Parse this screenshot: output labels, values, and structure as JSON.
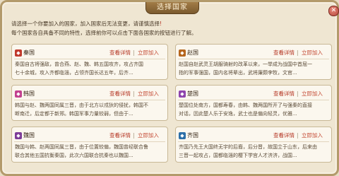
{
  "dialog": {
    "title": "选择国家",
    "close_symbol": "✕"
  },
  "intro": {
    "line1_prefix": "请选择一个你要加入的国家，加入国家后无法变更，请谨慎选择",
    "line1_mark": "!",
    "line2": "每个国家各自具备不同的特性，选择前你可以点击下面各国家的按钮进行了解。"
  },
  "links": {
    "detail": "查看详情",
    "join": "立即加入",
    "separator": "|"
  },
  "nations": [
    {
      "name": "秦国",
      "icon_color": "#c0392b",
      "line1": "秦国自古将强敌，曾合燕、赵、魏、韩五国攻齐，攻占齐国",
      "line2": "七十余城，攻入齐都临淄，占领齐国长达五年，后齐..."
    },
    {
      "name": "赵国",
      "icon_color": "#b5651d",
      "line1": "赵国自赵武灵王胡服骑射的改革以来，一举成为战国中首屈一",
      "line2": "指的军事强国，国内名将辈出，武将廉颇李牧，文官..."
    },
    {
      "name": "韩国",
      "icon_color": "#c2408f",
      "line1": "韩国与赵、魏两国同属三晋，由于北方以戎狄的侵扰，韩国不",
      "line2": "断南迁，后定都于新郑。韩国军事力量较弱，但由于..."
    },
    {
      "name": "楚国",
      "icon_color": "#8e44ad",
      "line1": "楚国位处南方，国都寿春，由韩、魏两国所开了与强秦的直接",
      "line2": "对话，因此楚人乐于安逸，武士也是偏向轻灵，优雅..."
    },
    {
      "name": "魏国",
      "icon_color": "#7d3c98",
      "line1": "魏国与韩、赵两国同属三晋，由于位置较偏，魏国曾经联合鲁",
      "line2": "联合其他五国抗衡秦国，此次六国联合抗秦也以魏国..."
    },
    {
      "name": "齐国",
      "icon_color": "#2c6fa8",
      "line1": "齐国乃先王大国终无宇的后裔，后分晋，故国立于山东，后来由",
      "line2": "三晋一起攻占，国都临淄的樱下学宫人才济济，战国..."
    }
  ]
}
